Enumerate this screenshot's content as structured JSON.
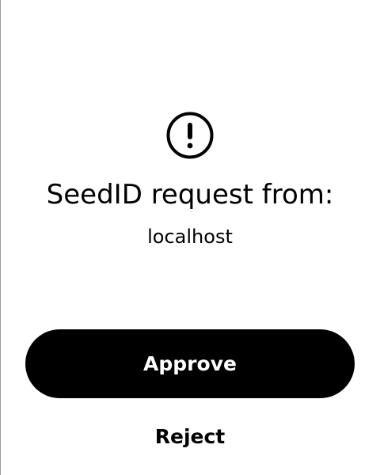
{
  "dialog": {
    "icon": "alert-circle-icon",
    "title": "SeedID request from:",
    "origin": "localhost"
  },
  "actions": {
    "approve_label": "Approve",
    "reject_label": "Reject"
  },
  "colors": {
    "background": "#ffffff",
    "text": "#000000",
    "primary_button": "#000000",
    "primary_button_text": "#ffffff",
    "border": "#9a9a9a"
  }
}
